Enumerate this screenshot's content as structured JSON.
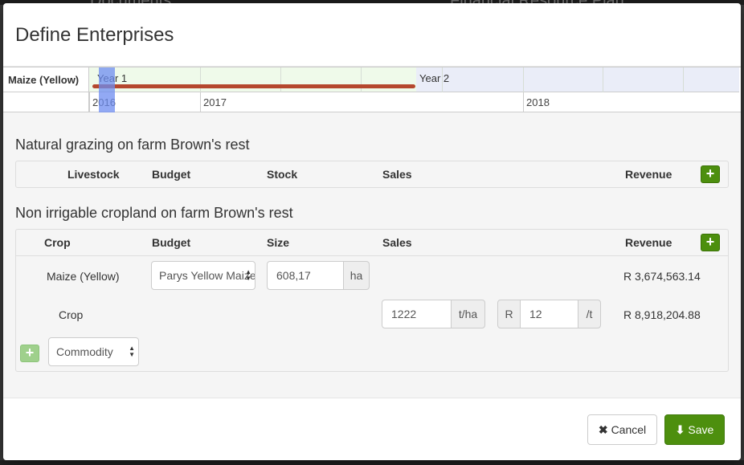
{
  "backdrop": {
    "left_text": "Documents",
    "right_text": "Financial Resource Plan"
  },
  "modal": {
    "title": "Define Enterprises"
  },
  "timeline": {
    "row_label": "Maize (Yellow)",
    "years": [
      "Year 1",
      "Year 2"
    ],
    "dates": [
      "2016",
      "2017",
      "2018"
    ]
  },
  "grazing": {
    "title": "Natural grazing on farm Brown's rest",
    "columns": {
      "livestock": "Livestock",
      "budget": "Budget",
      "stock": "Stock",
      "sales": "Sales",
      "revenue": "Revenue"
    },
    "add_label": "+"
  },
  "cropland": {
    "title": "Non irrigable cropland on farm Brown's rest",
    "columns": {
      "crop": "Crop",
      "budget": "Budget",
      "size": "Size",
      "sales": "Sales",
      "revenue": "Revenue"
    },
    "add_label": "+",
    "rows": [
      {
        "crop": "Maize (Yellow)",
        "budget_selected": "Parys Yellow Maize",
        "size_value": "608,17",
        "size_unit": "ha",
        "revenue": "R 3,674,563.14"
      }
    ],
    "subrow": {
      "label": "Crop",
      "yield_value": "1222",
      "yield_unit": "t/ha",
      "price_prefix": "R",
      "price_value": "12",
      "price_unit": "/t",
      "revenue": "R 8,918,204.88"
    },
    "commodity_add_label": "+",
    "commodity_selected": "Commodity"
  },
  "footer": {
    "cancel_icon": "✖",
    "cancel_label": "Cancel",
    "save_icon": "⬇",
    "save_label": "Save"
  },
  "colors": {
    "primary_green": "#4d8f0e",
    "timeline_bar": "#b5472e",
    "today_marker": "#6e8cf0"
  }
}
